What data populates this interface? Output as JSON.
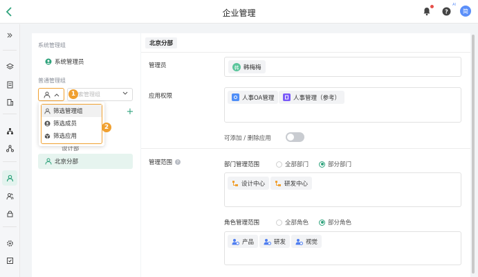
{
  "header": {
    "title": "企业管理",
    "avatar_text": "简",
    "ai_badge": "AI"
  },
  "groups": {
    "system_title": "系统管理组",
    "system_admin_label": "系统管理员",
    "normal_title": "普通管理组",
    "search_placeholder": "搜索管理组",
    "partial_hidden_item": "设计部",
    "beijing_item": "北京分部"
  },
  "filter_menu": {
    "items": [
      "筛选管理组",
      "筛选成员",
      "筛选应用"
    ],
    "step1": "1",
    "step2": "2"
  },
  "content": {
    "dept_title": "北京分部",
    "admin_label": "管理员",
    "admin_person": "韩梅梅",
    "admin_avatar": "韩",
    "app_perm_label": "应用权限",
    "apps": [
      "人事OA管理",
      "人事管理（参考）"
    ],
    "toggle_label": "可添加 / 删除应用",
    "scope_label": "管理范围",
    "dept_scope_label": "部门管理范围",
    "dept_radio_all": "全部部门",
    "dept_radio_part": "部分部门",
    "depts": [
      "设计中心",
      "研发中心"
    ],
    "role_scope_label": "角色管理范围",
    "role_radio_all": "全部角色",
    "role_radio_part": "部分角色",
    "roles": [
      "产品",
      "研发",
      "视觉"
    ]
  },
  "colors": {
    "accent": "#2fa37c",
    "highlight": "#f0a030"
  }
}
